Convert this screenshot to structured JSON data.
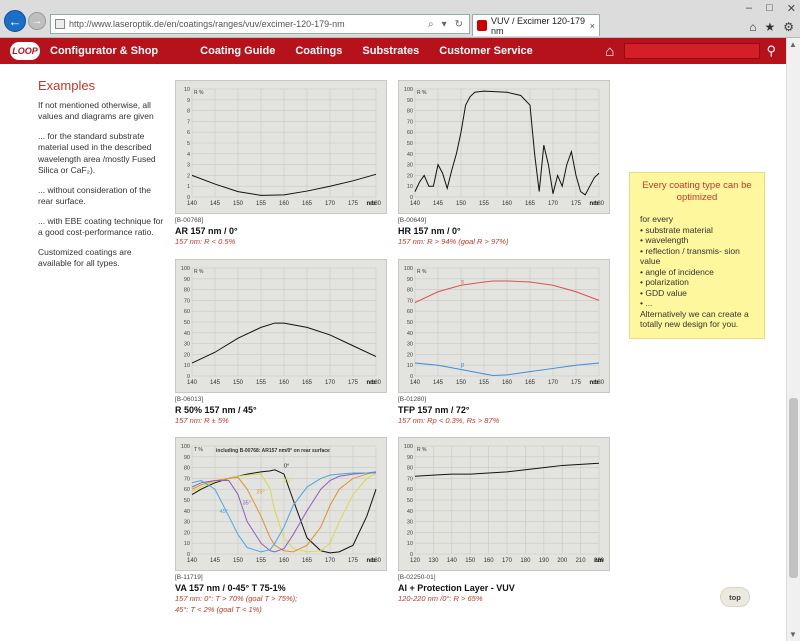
{
  "browser": {
    "url": "http://www.laseroptik.de/en/coatings/ranges/vuv/excimer-120-179-nm",
    "tab_title": "VUV / Excimer 120-179 nm",
    "tab_close": "×",
    "win_min": "–",
    "win_max": "□",
    "win_close": "✕"
  },
  "nav": {
    "logo": "LOOP",
    "items": [
      "Configurator & Shop",
      "Coating Guide",
      "Coatings",
      "Substrates",
      "Customer Service"
    ],
    "home_icon": "home-icon",
    "search_icon": "search-icon"
  },
  "left": {
    "heading": "Examples",
    "p1": "If not mentioned otherwise, all values and diagrams are given",
    "p2": "... for the standard substrate material used in the described wavelength area /mostly Fused Silica or CaF₂).",
    "p3": "... without consideration of the rear surface.",
    "p4": "... with EBE coating technique for a good cost-performance ratio.",
    "p5": "Customized coatings are available for all types."
  },
  "charts": [
    {
      "id": "[B-00768]",
      "title": "AR 157 nm / 0°",
      "sub": "157 nm: R < 0.5%",
      "ylabel": "R %",
      "xlabel": "nm"
    },
    {
      "id": "[B-00649]",
      "title": "HR 157 nm / 0°",
      "sub": "157 nm: R > 94% (goal R > 97%)",
      "ylabel": "R %",
      "xlabel": "nm"
    },
    {
      "id": "[B-06013]",
      "title": "R 50% 157 nm / 45°",
      "sub": "157 nm: R ± 5%",
      "ylabel": "R %",
      "xlabel": "nm"
    },
    {
      "id": "[B-01280]",
      "title": "TFP 157 nm / 72°",
      "sub": "157 nm: Rp < 0.3%, Rs > 87%",
      "ylabel": "R %",
      "xlabel": "nm",
      "s_label": "s",
      "p_label": "p"
    },
    {
      "id": "[B-11719]",
      "title": "VA 157 nm / 0-45° T 75-1%",
      "sub": "157 nm: 0°: T > 70% (goal T > 75%);",
      "sub2": "45°: T < 2% (goal T < 1%)",
      "ylabel": "T %",
      "xlabel": "nm",
      "note": "including B-00768: AR157 nm/0° on rear surface",
      "angles": [
        "0°",
        "15°",
        "25°",
        "35°",
        "45°"
      ]
    },
    {
      "id": "[B-02250-01]",
      "title": "Al + Protection Layer - VUV",
      "sub": "120-220 nm /0°: R > 65%",
      "ylabel": "R %",
      "xlabel": "nm"
    }
  ],
  "chart_data": [
    {
      "type": "line",
      "title": "AR 157 nm / 0°",
      "xlabel": "nm",
      "ylabel": "R %",
      "xlim": [
        140,
        180
      ],
      "ylim": [
        0,
        10
      ],
      "x": [
        140,
        145,
        150,
        155,
        160,
        165,
        170,
        175,
        180
      ],
      "series": [
        {
          "values": [
            2.0,
            1.2,
            0.5,
            0.15,
            0.2,
            0.55,
            1.0,
            1.5,
            2.1
          ]
        }
      ],
      "xticks": [
        140,
        145,
        150,
        155,
        160,
        165,
        170,
        175,
        180
      ],
      "yticks": [
        0,
        1,
        2,
        3,
        4,
        5,
        6,
        7,
        8,
        9,
        10
      ]
    },
    {
      "type": "line",
      "title": "HR 157 nm / 0°",
      "xlabel": "nm",
      "ylabel": "R %",
      "xlim": [
        140,
        180
      ],
      "ylim": [
        0,
        100
      ],
      "x": [
        140,
        141,
        142,
        143,
        144,
        145,
        146,
        147,
        148,
        149,
        150,
        151,
        152,
        153,
        155,
        160,
        163,
        165,
        166,
        167,
        168,
        169,
        170,
        171,
        172,
        173,
        174,
        175,
        176,
        177,
        178,
        179,
        180
      ],
      "series": [
        {
          "values": [
            5,
            14,
            20,
            10,
            10,
            30,
            22,
            8,
            25,
            40,
            60,
            85,
            93,
            97,
            98,
            97,
            94,
            85,
            40,
            5,
            48,
            30,
            3,
            20,
            10,
            30,
            42,
            20,
            5,
            2,
            10,
            18,
            22
          ]
        }
      ],
      "xticks": [
        140,
        145,
        150,
        155,
        160,
        165,
        170,
        175,
        180
      ],
      "yticks": [
        0,
        10,
        20,
        30,
        40,
        50,
        60,
        70,
        80,
        90,
        100
      ]
    },
    {
      "type": "line",
      "title": "R 50% 157 nm / 45°",
      "xlabel": "nm",
      "ylabel": "R %",
      "xlim": [
        140,
        180
      ],
      "ylim": [
        0,
        100
      ],
      "x": [
        140,
        145,
        150,
        155,
        158,
        160,
        165,
        170,
        175,
        180
      ],
      "series": [
        {
          "values": [
            12,
            22,
            35,
            45,
            49,
            49,
            45,
            38,
            28,
            18
          ]
        }
      ],
      "xticks": [
        140,
        145,
        150,
        155,
        160,
        165,
        170,
        175,
        180
      ],
      "yticks": [
        0,
        10,
        20,
        30,
        40,
        50,
        60,
        70,
        80,
        90,
        100
      ]
    },
    {
      "type": "line",
      "title": "TFP 157 nm / 72°",
      "xlabel": "nm",
      "ylabel": "R %",
      "xlim": [
        140,
        180
      ],
      "ylim": [
        0,
        100
      ],
      "x": [
        140,
        145,
        150,
        155,
        157,
        160,
        165,
        170,
        175,
        180
      ],
      "series": [
        {
          "name": "s",
          "values": [
            68,
            78,
            84,
            87,
            88,
            88,
            87,
            84,
            78,
            70
          ]
        },
        {
          "name": "p",
          "values": [
            12,
            10,
            6,
            2,
            0.5,
            1,
            4,
            7,
            10,
            12
          ]
        }
      ],
      "xticks": [
        140,
        145,
        150,
        155,
        160,
        165,
        170,
        175,
        180
      ],
      "yticks": [
        0,
        10,
        20,
        30,
        40,
        50,
        60,
        70,
        80,
        90,
        100
      ]
    },
    {
      "type": "line",
      "title": "VA 157 nm / 0-45° T 75-1%",
      "xlabel": "nm",
      "ylabel": "T %",
      "xlim": [
        140,
        180
      ],
      "ylim": [
        0,
        100
      ],
      "x": [
        140,
        142,
        145,
        148,
        150,
        152,
        155,
        157,
        158,
        160,
        162,
        165,
        168,
        170,
        172,
        175,
        178,
        180
      ],
      "series": [
        {
          "name": "0°",
          "values": [
            55,
            60,
            66,
            70,
            72,
            74,
            76,
            77,
            78,
            74,
            50,
            15,
            3,
            1,
            2,
            8,
            35,
            60
          ]
        },
        {
          "name": "15°",
          "values": [
            58,
            62,
            67,
            70,
            72,
            73,
            74,
            60,
            40,
            15,
            5,
            2,
            3,
            10,
            30,
            55,
            70,
            75
          ]
        },
        {
          "name": "25°",
          "values": [
            60,
            64,
            68,
            70,
            71,
            60,
            35,
            15,
            8,
            3,
            2,
            8,
            25,
            45,
            60,
            70,
            74,
            76
          ]
        },
        {
          "name": "35°",
          "values": [
            62,
            66,
            68,
            68,
            55,
            30,
            10,
            3,
            2,
            5,
            18,
            40,
            60,
            68,
            72,
            74,
            75,
            76
          ]
        },
        {
          "name": "45°",
          "values": [
            66,
            68,
            60,
            35,
            18,
            6,
            2,
            4,
            10,
            25,
            45,
            62,
            70,
            73,
            74,
            75,
            75,
            75
          ]
        }
      ],
      "xticks": [
        140,
        145,
        150,
        155,
        160,
        165,
        170,
        175,
        180
      ],
      "yticks": [
        0,
        10,
        20,
        30,
        40,
        50,
        60,
        70,
        80,
        90,
        100
      ]
    },
    {
      "type": "line",
      "title": "Al + Protection Layer - VUV",
      "xlabel": "nm",
      "ylabel": "R %",
      "xlim": [
        120,
        220
      ],
      "ylim": [
        0,
        100
      ],
      "x": [
        120,
        130,
        140,
        150,
        160,
        170,
        180,
        190,
        200,
        210,
        220
      ],
      "series": [
        {
          "values": [
            72,
            73,
            74,
            74,
            75,
            76,
            78,
            80,
            82,
            83,
            84
          ]
        }
      ],
      "xticks": [
        120,
        130,
        140,
        150,
        160,
        170,
        180,
        190,
        200,
        210,
        220
      ],
      "yticks": [
        0,
        10,
        20,
        30,
        40,
        50,
        60,
        70,
        80,
        90,
        100
      ]
    }
  ],
  "infobox": {
    "heading": "Every coating type can be optimized",
    "intro": "for every",
    "items": [
      "• substrate material",
      "• wavelength",
      "• reflection / transmis- sion value",
      "• angle of incidence",
      "• polarization",
      "• GDD value",
      "• ..."
    ],
    "outro": "Alternatively we can create a totally new design for you."
  },
  "top_label": "top",
  "colors": {
    "brand": "#b5121b",
    "accent_text": "#c0392b",
    "info_bg": "#fff79e",
    "line_s": "#d9534f",
    "line_p": "#3b8fd4"
  }
}
